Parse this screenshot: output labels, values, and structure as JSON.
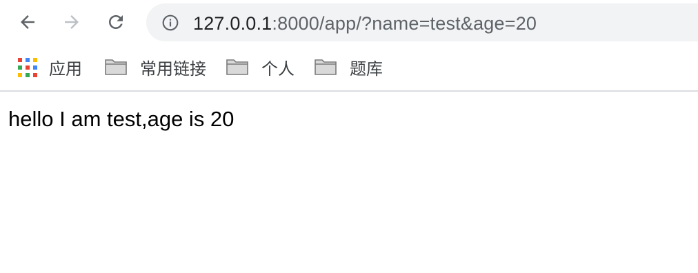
{
  "toolbar": {
    "back_icon": "arrow-left-icon",
    "forward_icon": "arrow-right-icon",
    "reload_icon": "reload-icon"
  },
  "omnibox": {
    "info_icon": "info-icon",
    "url_host": "127.0.0.1",
    "url_rest": ":8000/app/?name=test&age=20"
  },
  "bookmarks": {
    "items": [
      {
        "label": "应用",
        "icon": "apps-grid-icon"
      },
      {
        "label": "常用链接",
        "icon": "folder-icon"
      },
      {
        "label": "个人",
        "icon": "folder-icon"
      },
      {
        "label": "题库",
        "icon": "folder-icon"
      }
    ]
  },
  "page": {
    "body_text": "hello I am test,age is 20"
  },
  "colors": {
    "omnibox_bg": "#f1f3f4",
    "icon_active": "#5f6368",
    "icon_disabled": "#bdc1c6",
    "apps_grid": [
      "#ea4335",
      "#4285f4",
      "#fbbc04",
      "#34a853"
    ]
  }
}
